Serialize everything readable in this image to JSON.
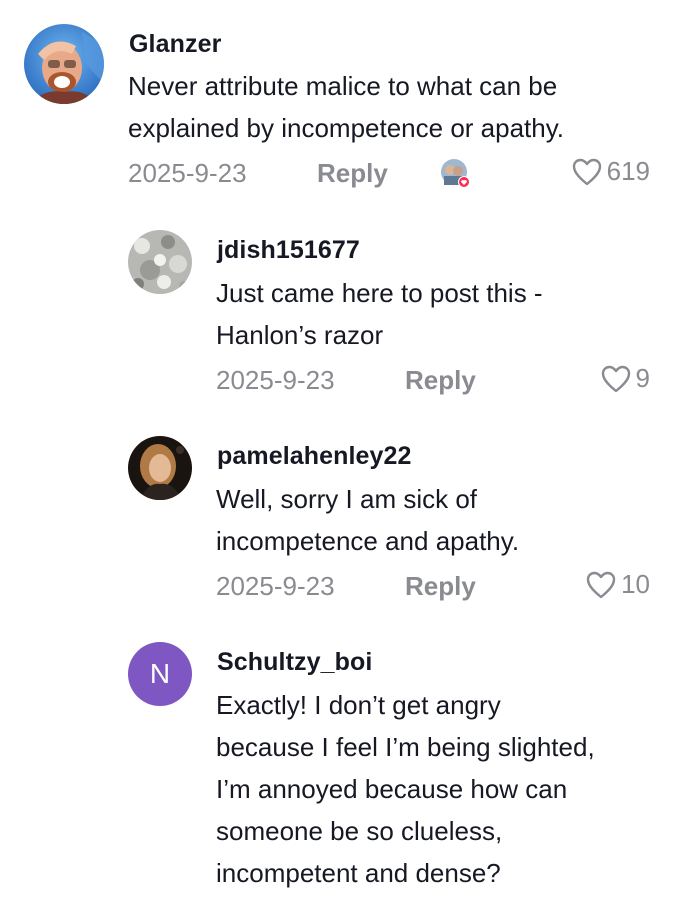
{
  "comments": [
    {
      "username": "Glanzer",
      "text": "Never attribute malice to what can be\nexplained by incompetence or apathy.",
      "date": "2025-9-23",
      "reply_label": "Reply",
      "likes": "619",
      "avatar_icon": "profile-photo-icon"
    },
    {
      "username": "jdish151677",
      "text": "Just came here to post this -\nHanlon’s razor",
      "date": "2025-9-23",
      "reply_label": "Reply",
      "likes": "9",
      "avatar_icon": "profile-photo-icon"
    },
    {
      "username": "pamelahenley22",
      "text": "Well, sorry I am sick of\nincompetence and apathy.",
      "date": "2025-9-23",
      "reply_label": "Reply",
      "likes": "10",
      "avatar_icon": "profile-photo-icon"
    },
    {
      "username": "Schultzy_boi",
      "text": "Exactly! I don’t get angry\nbecause I feel I’m being slighted,\nI’m annoyed because how can\nsomeone be so clueless,\nincompetent and dense?",
      "avatar_letter": "N",
      "avatar_color": "#7e57c2"
    }
  ],
  "colors": {
    "primary_text": "#161823",
    "secondary_text": "#8a8b91",
    "heart_badge": "#fe2c55"
  },
  "icons": {
    "like": "heart-outline-icon",
    "creator_liked": "creator-liked-badge-icon"
  }
}
